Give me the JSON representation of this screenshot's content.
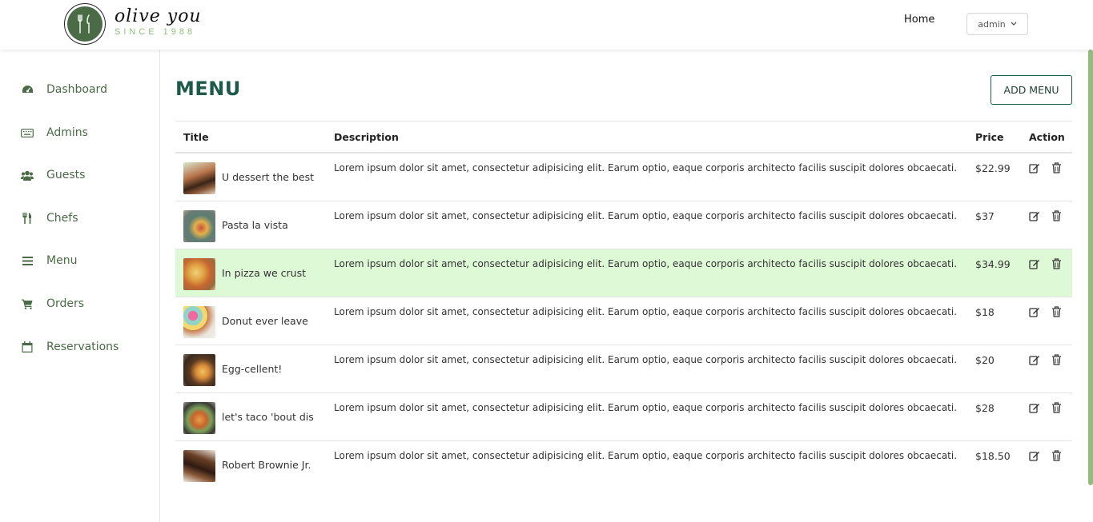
{
  "brand": {
    "name": "olive you",
    "tagline": "SINCE 1988"
  },
  "topnav": {
    "home": "Home",
    "user": "admin"
  },
  "sidebar": {
    "items": [
      {
        "label": "Dashboard",
        "icon": "dashboard-icon"
      },
      {
        "label": "Admins",
        "icon": "keyboard-icon"
      },
      {
        "label": "Guests",
        "icon": "users-icon"
      },
      {
        "label": "Chefs",
        "icon": "cutlery-icon"
      },
      {
        "label": "Menu",
        "icon": "menu-icon"
      },
      {
        "label": "Orders",
        "icon": "cart-icon"
      },
      {
        "label": "Reservations",
        "icon": "calendar-icon"
      }
    ]
  },
  "page": {
    "title": "MENU",
    "add_button": "ADD MENU"
  },
  "table": {
    "headers": {
      "title": "Title",
      "description": "Description",
      "price": "Price",
      "action": "Action"
    },
    "rows": [
      {
        "title": "U dessert the best",
        "description": "Lorem ipsum dolor sit amet, consectetur adipisicing elit. Earum optio, eaque corporis architecto facilis suscipit dolores obcaecati.",
        "price": "$22.99"
      },
      {
        "title": "Pasta la vista",
        "description": "Lorem ipsum dolor sit amet, consectetur adipisicing elit. Earum optio, eaque corporis architecto facilis suscipit dolores obcaecati.",
        "price": "$37"
      },
      {
        "title": "In pizza we crust",
        "description": "Lorem ipsum dolor sit amet, consectetur adipisicing elit. Earum optio, eaque corporis architecto facilis suscipit dolores obcaecati.",
        "price": "$34.99"
      },
      {
        "title": "Donut ever leave",
        "description": "Lorem ipsum dolor sit amet, consectetur adipisicing elit. Earum optio, eaque corporis architecto facilis suscipit dolores obcaecati.",
        "price": "$18"
      },
      {
        "title": "Egg-cellent!",
        "description": "Lorem ipsum dolor sit amet, consectetur adipisicing elit. Earum optio, eaque corporis architecto facilis suscipit dolores obcaecati.",
        "price": "$20"
      },
      {
        "title": "let's taco 'bout dis",
        "description": "Lorem ipsum dolor sit amet, consectetur adipisicing elit. Earum optio, eaque corporis architecto facilis suscipit dolores obcaecati.",
        "price": "$28"
      },
      {
        "title": "Robert Brownie Jr.",
        "description": "Lorem ipsum dolor sit amet, consectetur adipisicing elit. Earum optio, eaque corporis architecto facilis suscipit dolores obcaecati.",
        "price": "$18.50"
      }
    ]
  },
  "colors": {
    "accent": "#4a6b45",
    "title": "#1e5a4a",
    "highlight_row": "#ddf9d6",
    "scroll_accent": "#8fbf7a"
  }
}
